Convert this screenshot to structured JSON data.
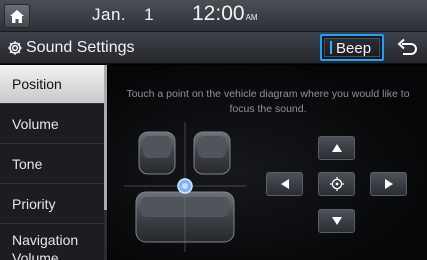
{
  "status": {
    "month": "Jan.",
    "day": "1",
    "time": "12:00",
    "ampm": "AM"
  },
  "header": {
    "title": "Sound Settings",
    "beep_label": "Beep"
  },
  "sidebar": {
    "items": [
      {
        "label": "Position",
        "active": true
      },
      {
        "label": "Volume"
      },
      {
        "label": "Tone"
      },
      {
        "label": "Priority"
      },
      {
        "label": "Navigation Volume"
      }
    ]
  },
  "main": {
    "instruction": "Touch a point on the vehicle diagram where you would like to focus the sound."
  },
  "icons": {
    "home": "home-icon",
    "settings": "gear-icon",
    "back": "back-arrow-icon",
    "up": "up-arrow-icon",
    "down": "down-arrow-icon",
    "left": "left-arrow-icon",
    "right": "right-arrow-icon",
    "center": "center-target-icon"
  },
  "colors": {
    "accent": "#1aa0ff",
    "active_bg": "#e6e6e6",
    "focus_point": "#4b8de6"
  }
}
